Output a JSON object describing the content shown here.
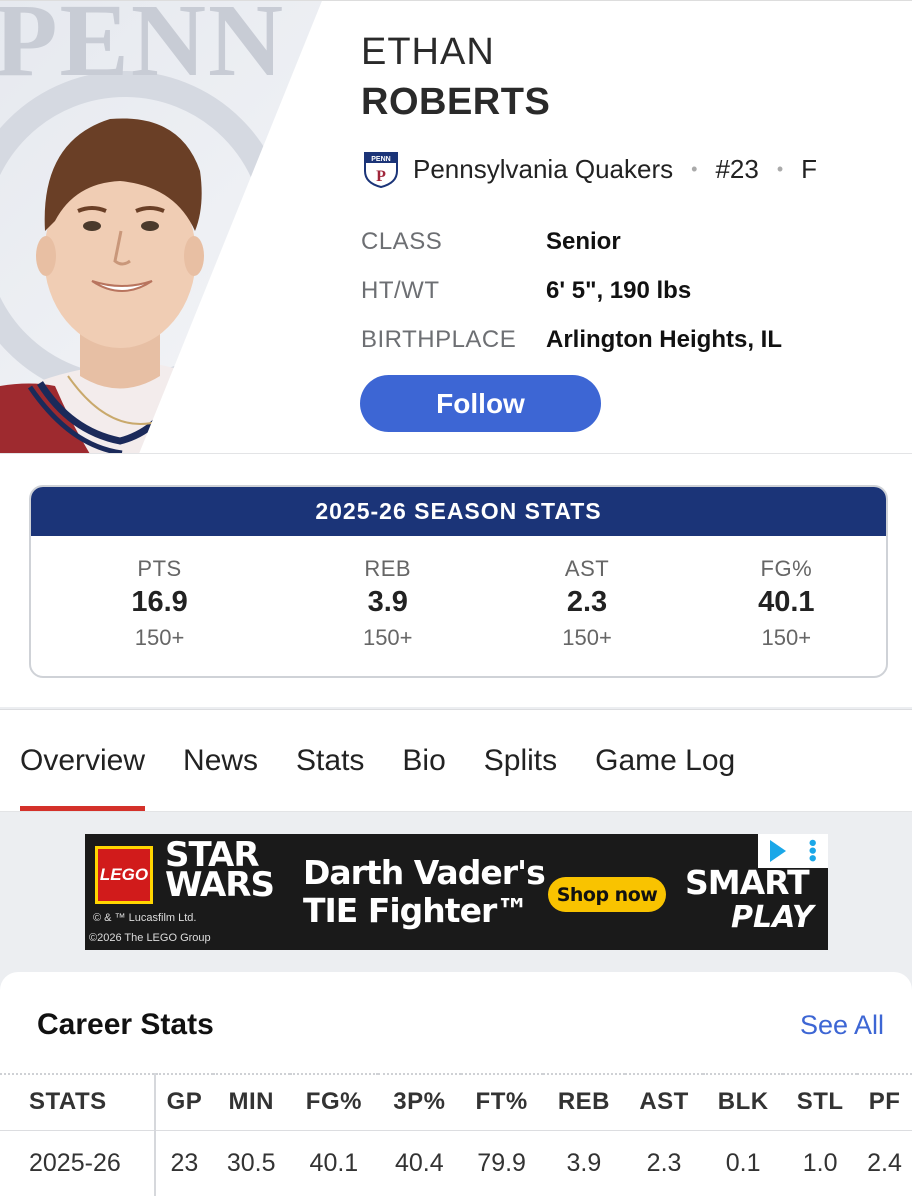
{
  "hero": {
    "watermark": "PENN"
  },
  "player": {
    "first_name": "ETHAN",
    "last_name": "ROBERTS",
    "team": "Pennsylvania Quakers",
    "number": "#23",
    "position": "F",
    "team_logo_text": "PENN"
  },
  "info": [
    {
      "label": "CLASS",
      "value": "Senior"
    },
    {
      "label": "HT/WT",
      "value": "6' 5\", 190 lbs"
    },
    {
      "label": "BIRTHPLACE",
      "value": "Arlington Heights, IL"
    }
  ],
  "follow_label": "Follow",
  "season": {
    "title": "2025-26 SEASON STATS",
    "stats": [
      {
        "label": "PTS",
        "value": "16.9",
        "rank": "150+"
      },
      {
        "label": "REB",
        "value": "3.9",
        "rank": "150+"
      },
      {
        "label": "AST",
        "value": "2.3",
        "rank": "150+"
      },
      {
        "label": "FG%",
        "value": "40.1",
        "rank": "150+"
      }
    ]
  },
  "tabs": [
    "Overview",
    "News",
    "Stats",
    "Bio",
    "Splits",
    "Game Log"
  ],
  "ad": {
    "lego": "LEGO",
    "sw_line1": "STAR",
    "sw_line2": "WARS",
    "copyright1": "© & ™ Lucasfilm Ltd.",
    "copyright2": "©2026 The LEGO Group",
    "headline1": "Darth Vader's",
    "headline2": "TIE Fighter™",
    "cta": "Shop now",
    "brand1": "SMART",
    "brand2": "PLAY"
  },
  "career": {
    "title": "Career Stats",
    "see_all": "See All",
    "headers": [
      "STATS",
      "GP",
      "MIN",
      "FG%",
      "3P%",
      "FT%",
      "REB",
      "AST",
      "BLK",
      "STL",
      "PF"
    ],
    "rows": [
      [
        "2025-26",
        "23",
        "30.5",
        "40.1",
        "40.4",
        "79.9",
        "3.9",
        "2.3",
        "0.1",
        "1.0",
        "2.4"
      ]
    ]
  },
  "colors": {
    "accent": "#3d66d4",
    "navy": "#1b3478",
    "tab_underline": "#d4312a",
    "ad_cta": "#f9c300"
  }
}
